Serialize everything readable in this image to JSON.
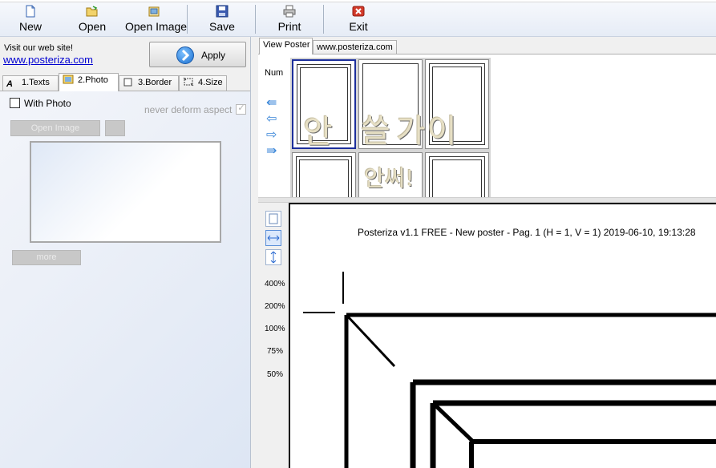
{
  "toolbar": {
    "items": [
      {
        "label": "New",
        "icon": "new-document-icon"
      },
      {
        "label": "Open",
        "icon": "open-folder-icon"
      },
      {
        "label": "Open Image",
        "icon": "open-image-icon"
      },
      {
        "label": "Save",
        "icon": "save-disk-icon"
      },
      {
        "label": "Print",
        "icon": "printer-icon"
      },
      {
        "label": "Exit",
        "icon": "exit-x-icon"
      }
    ]
  },
  "left": {
    "visit_text": "Visit our web site!",
    "visit_link": "www.posteriza.com",
    "apply_label": "Apply",
    "tabs": [
      {
        "label": "1.Texts",
        "icon": "text-icon"
      },
      {
        "label": "2.Photo",
        "icon": "photo-icon"
      },
      {
        "label": "3.Border",
        "icon": "border-icon"
      },
      {
        "label": "4.Size",
        "icon": "size-icon"
      }
    ],
    "photo": {
      "with_photo_label": "With Photo",
      "with_photo_checked": false,
      "never_deform_label": "never deform aspect",
      "never_deform_checked": true,
      "open_image_label": "Open Image",
      "more_label": "more"
    }
  },
  "right": {
    "tabs": [
      {
        "label": "View Poster"
      },
      {
        "label": "www.posteriza.com"
      }
    ],
    "num_label": "Num",
    "thumb_chars": [
      "안",
      "쓸",
      "가",
      "이",
      "안써!"
    ],
    "zoom_levels": [
      "400%",
      "200%",
      "100%",
      "75%",
      "50%"
    ],
    "preview_caption": "Posteriza v1.1 FREE - New poster - Pag. 1 (H = 1, V = 1) 2019-06-10, 19:13:28"
  },
  "colors": {
    "link": "#0000d0",
    "selected_thumb_border": "#1c2f9c",
    "accent_blue": "#3a86d8"
  }
}
